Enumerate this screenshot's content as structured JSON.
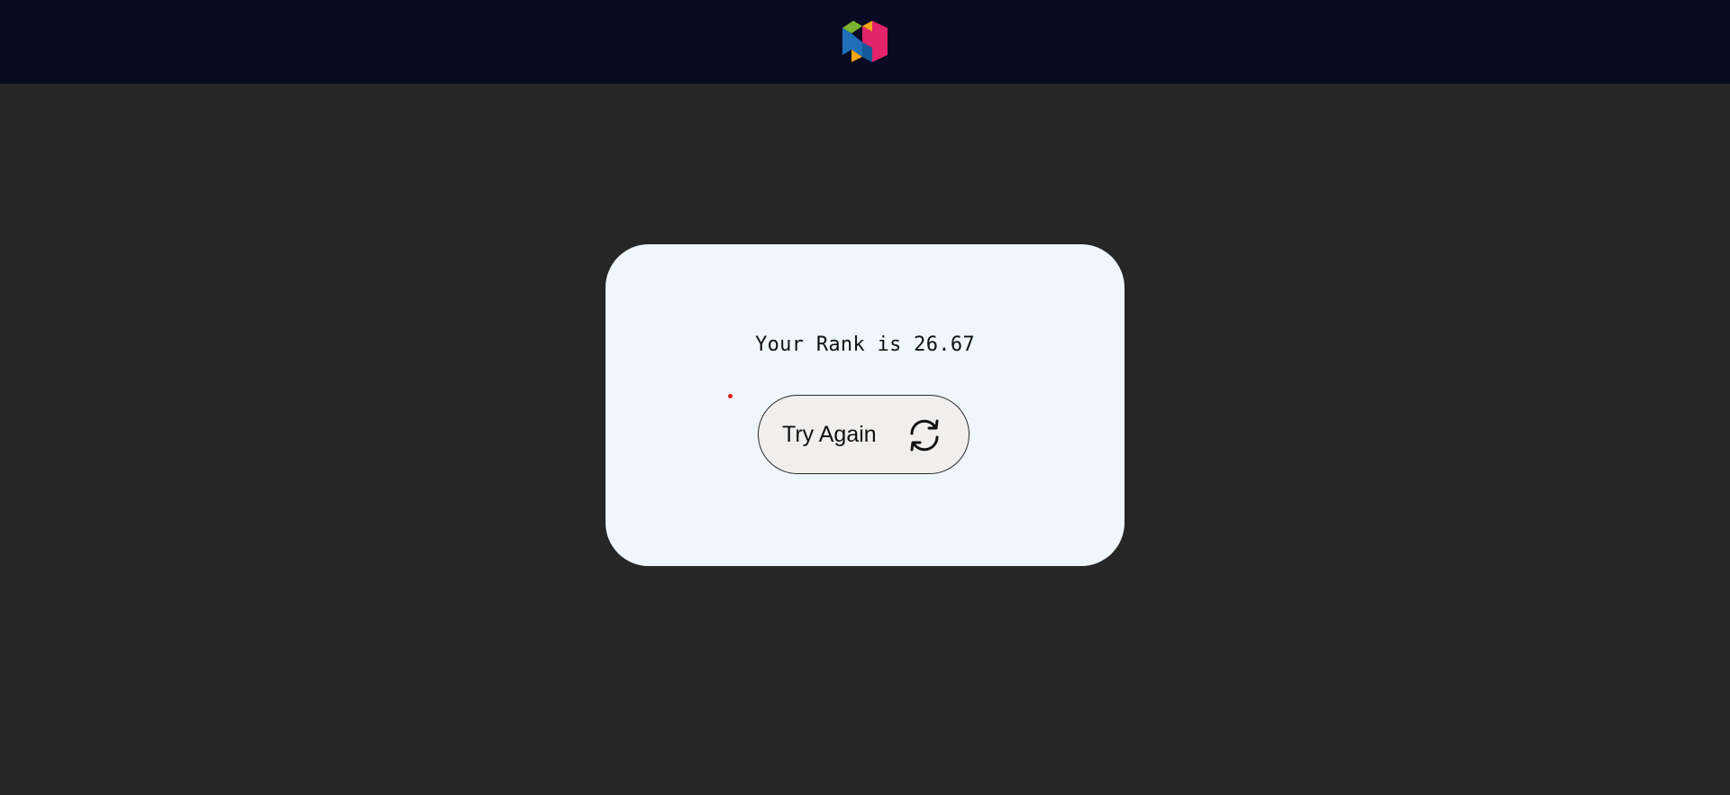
{
  "header": {
    "logo_icon": "brand-logo-icon",
    "background_color": "#0a0b22"
  },
  "result_card": {
    "rank_text": "Your Rank is 26.67",
    "try_again_label": "Try Again",
    "try_again_icon": "refresh-icon",
    "background_color": "#eff6fe"
  },
  "page": {
    "background_color": "#262626"
  }
}
